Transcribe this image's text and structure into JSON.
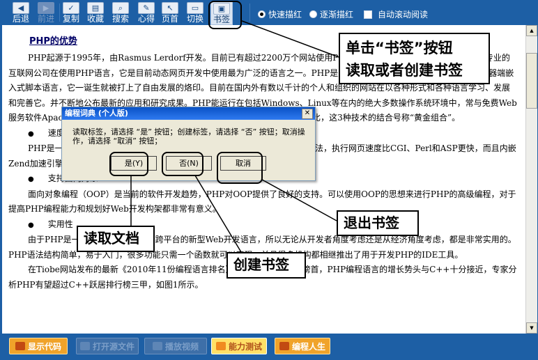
{
  "toolbar": {
    "buttons": [
      {
        "label": "后退",
        "icon": "back-arrow-icon",
        "glyph": "◀",
        "enabled": true
      },
      {
        "label": "前进",
        "icon": "forward-arrow-icon",
        "glyph": "▶",
        "enabled": false
      },
      {
        "label": "复制",
        "icon": "copy-icon",
        "glyph": "✓",
        "enabled": true
      },
      {
        "label": "收藏",
        "icon": "favorite-icon",
        "glyph": "▤",
        "enabled": true
      },
      {
        "label": "搜索",
        "icon": "search-icon",
        "glyph": "⌕",
        "enabled": true
      },
      {
        "label": "心得",
        "icon": "notes-icon",
        "glyph": "✎",
        "enabled": true
      },
      {
        "label": "页首",
        "icon": "page-top-icon",
        "glyph": "↖",
        "enabled": true
      },
      {
        "label": "切换",
        "icon": "switch-icon",
        "glyph": "▭",
        "enabled": true
      },
      {
        "label": "书签",
        "icon": "bookmark-icon",
        "glyph": "▣",
        "enabled": true,
        "active": true
      }
    ],
    "radio_fast": "快速描红",
    "radio_gradual": "逐渐描红",
    "auto_scroll": "自动滚动阅读",
    "radio_selected": "快速描红"
  },
  "content": {
    "heading": "PHP的优势",
    "paragraph1": "PHP起源于1995年，由Rasmus Lerdorf开发。目前已有超过2200万个网站使用PHP，并且这个数字还在增长。全球众多专业的互联网公司在使用PHP语言，它是目前动态网页开发中使用最为广泛的语言之一。PHP是生于网络长于网络的语言，它是一种服务器端嵌入式脚本语言，它一诞生就被打上了自由发展的烙印。目前在国内外有数以千计的个人和组织的网站在以各种形式和各种语言学习、发展和完善它。并不断地公布最新的应用和研究成果。PHP能运行在包括Windows、Linux等在内的绝大多数操作系统环境中，常与免费Web服务软件Apache和免费数据库MySQL配合使用于Linux平台上，具有最高的性价比，这3种技术的结合号称“黄金组合”。",
    "bullet1": "速度快",
    "paragraph2": "PHP是一种强大的CGI脚本语言，语法混合了C、Java、Perl和PHP式的新语法，执行网页速度比CGI、Perl和ASP更快，而且内嵌Zend加速引擎，性能稳定快速，这是它的第一个突出的特点。",
    "bullet2": "支持面向对象",
    "paragraph3": "面向对象编程（OOP）是当前的软件开发趋势，PHP对OOP提供了良好的支持。可以使用OOP的思想来进行PHP的高级编程，对于提高PHP编程能力和规划好Web开发构架都非常有意义。",
    "bullet3": "实用性",
    "paragraph4": "由于PHP是一种面向对象的、完全跨平台的新型Web开发语言，所以无论从开发者角度考虑还是从经济角度考虑，都是非常实用的。PHP语法结构简单，易于入门，很多功能只需一个函数就可以实现，并且很多机构都相继推出了用于开发PHP的IDE工具。",
    "paragraph5": "在Tiobe网站发布的最新《2010年11份编程语言排名》中，Java仍然跃居榜首，PHP编程语言的增长势头与C++十分接近，专家分析PHP有望超过C++跃居排行榜三甲，如图1所示。"
  },
  "dialog": {
    "title": "编程词典 (个人版)",
    "message": "读取标签，请选择 “是” 按钮；创建标签，请选择 “否” 按钮；取消操作，请选择 “取消” 按钮；",
    "yes": "是(Y)",
    "no": "否(N)",
    "cancel": "取消"
  },
  "bottom": {
    "show_code": "显示代码",
    "open_file": "打开源文件",
    "video": "播放视频",
    "ability_test": "能力测试",
    "programming_life": "编程人生"
  },
  "callouts": {
    "bookmark": "单击“书签”按钮\n读取或者创建书签",
    "exit": "退出书签",
    "read": "读取文档",
    "create": "创建书签"
  }
}
